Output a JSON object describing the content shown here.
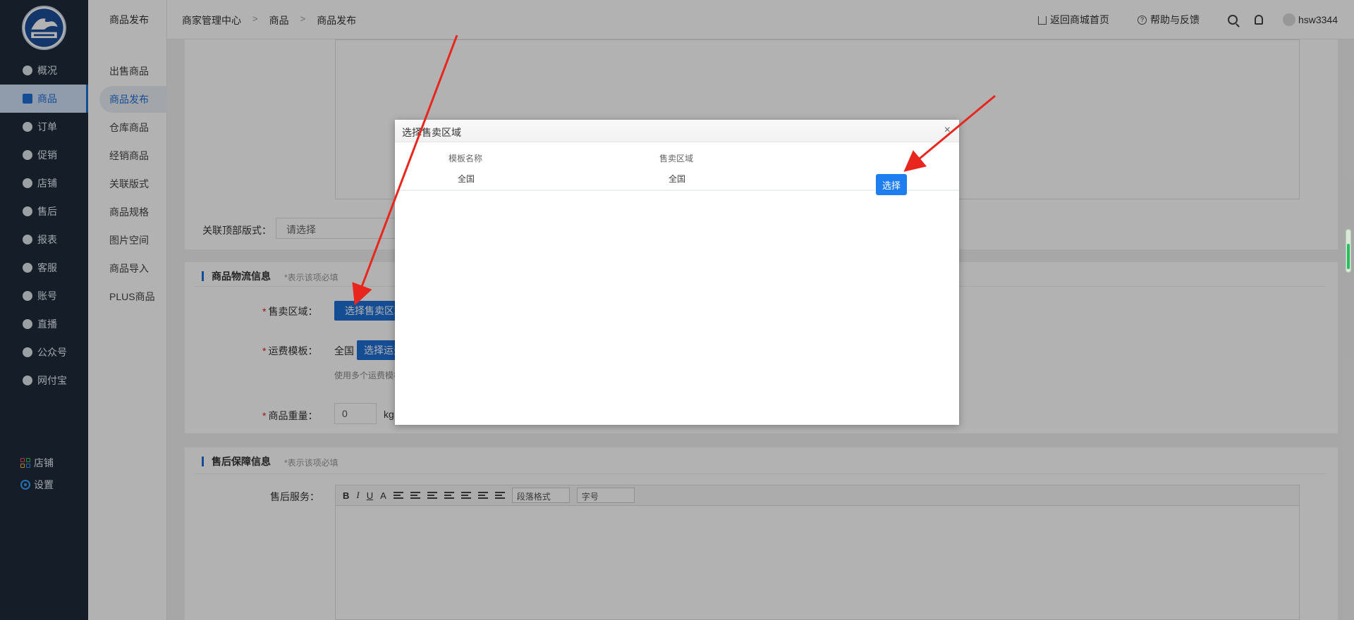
{
  "nav": {
    "items": [
      {
        "label": "概况",
        "icon": "dashboard-icon"
      },
      {
        "label": "商品",
        "icon": "bag-icon"
      },
      {
        "label": "订单",
        "icon": "bar-chart-icon"
      },
      {
        "label": "促销",
        "icon": "promotion-icon"
      },
      {
        "label": "店铺",
        "icon": "store-icon"
      },
      {
        "label": "售后",
        "icon": "after-sale-icon"
      },
      {
        "label": "报表",
        "icon": "report-icon"
      },
      {
        "label": "客服",
        "icon": "service-icon"
      },
      {
        "label": "账号",
        "icon": "wallet-icon"
      },
      {
        "label": "直播",
        "icon": "live-icon"
      },
      {
        "label": "公众号",
        "icon": "badge-icon"
      },
      {
        "label": "网付宝",
        "icon": "shield-icon"
      }
    ],
    "bottom": [
      {
        "label": "店铺",
        "icon": "apps-grid-icon"
      },
      {
        "label": "设置",
        "icon": "settings-icon"
      }
    ]
  },
  "subnav": {
    "title": "商品发布",
    "items": [
      "出售商品",
      "商品发布",
      "仓库商品",
      "经销商品",
      "关联版式",
      "商品规格",
      "图片空间",
      "商品导入",
      "PLUS商品"
    ]
  },
  "header": {
    "breadcrumb": [
      "商家管理中心",
      "商品",
      "商品发布"
    ],
    "home_link": "返回商城首页",
    "help_link": "帮助与反馈",
    "username": "hsw3344"
  },
  "form": {
    "top_layout_label": "关联顶部版式：",
    "top_layout_placeholder": "请选择",
    "logistics_title": "商品物流信息",
    "required_note": "*表示该项必填",
    "sale_area_label": "售卖区域：",
    "sale_area_button": "选择售卖区域",
    "freight_label": "运费模板：",
    "freight_value": "全国",
    "freight_button": "选择运费模板",
    "freight_hint": "使用多个运费模板",
    "weight_label": "商品重量：",
    "weight_value": "0",
    "weight_unit": "kg",
    "aftersale_title": "售后保障信息",
    "aftersale_note": "*表示该项必填",
    "aftersale_service_label": "售后服务：",
    "toolbar": {
      "bold": "B",
      "italic": "I",
      "underline": "U",
      "font_color": "A",
      "paragraph": "段落格式",
      "font_size": "字号"
    }
  },
  "modal": {
    "title": "选择售卖区域",
    "close": "×",
    "columns": [
      "模板名称",
      "售卖区域"
    ],
    "rows": [
      {
        "name": "全国",
        "area": "全国",
        "action": "选择"
      }
    ]
  },
  "colors": {
    "nav_bg": "#1e2a3a",
    "accent": "#1f6fd6",
    "button": "#1e7ef0",
    "arrow": "#e8261d"
  }
}
